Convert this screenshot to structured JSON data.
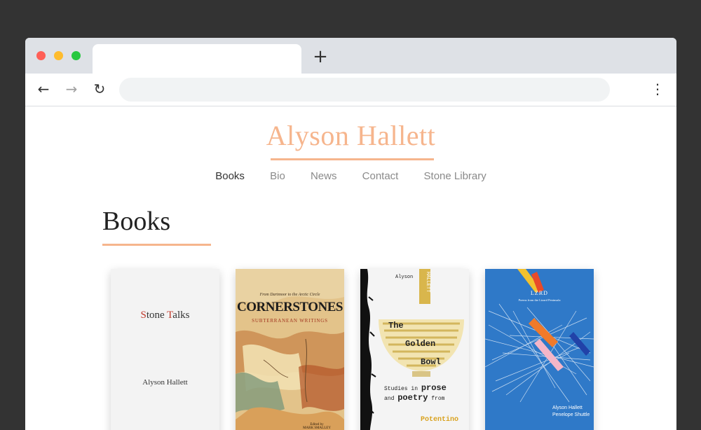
{
  "browser": {
    "new_tab_symbol": "+",
    "back_symbol": "←",
    "forward_symbol": "→",
    "reload_symbol": "↻",
    "menu_symbol": "⋮",
    "address": "",
    "colors": {
      "chrome": "#dee1e6",
      "close": "#ff5f57",
      "minimize": "#febc2e",
      "maximize": "#28c840"
    }
  },
  "site": {
    "title": "Alyson Hallett",
    "accent_color": "#f6b58d",
    "nav": [
      {
        "label": "Books",
        "active": true
      },
      {
        "label": "Bio",
        "active": false
      },
      {
        "label": "News",
        "active": false
      },
      {
        "label": "Contact",
        "active": false
      },
      {
        "label": "Stone Library",
        "active": false
      }
    ]
  },
  "main": {
    "heading": "Books",
    "books": [
      {
        "title_accent_1": "S",
        "title_rest_1": "tone ",
        "title_accent_2": "T",
        "title_rest_2": "alks",
        "author": "Alyson Hallett"
      },
      {
        "tagline": "From Dartmoor to the Arctic Circle",
        "title": "CORNERSTONES",
        "subtitle": "SUBTERRANEAN WRITINGS",
        "editor_line": "Edited by",
        "editor": "MARK SMALLEY"
      },
      {
        "author": "Alyson",
        "band_text": "HALLETT",
        "title_1": "The",
        "title_2": "Golden",
        "title_3": "Bowl",
        "subtitle_1": "Studies in",
        "subtitle_big_1": "prose",
        "subtitle_2": "and",
        "subtitle_big_2": "poetry",
        "subtitle_3": "from",
        "place": "Potentino"
      },
      {
        "title": "LZRD",
        "subtitle": "Poems from the Lizard Peninsula",
        "author_1": "Alyson Hallett",
        "author_2": "Penelope Shuttle"
      }
    ]
  }
}
